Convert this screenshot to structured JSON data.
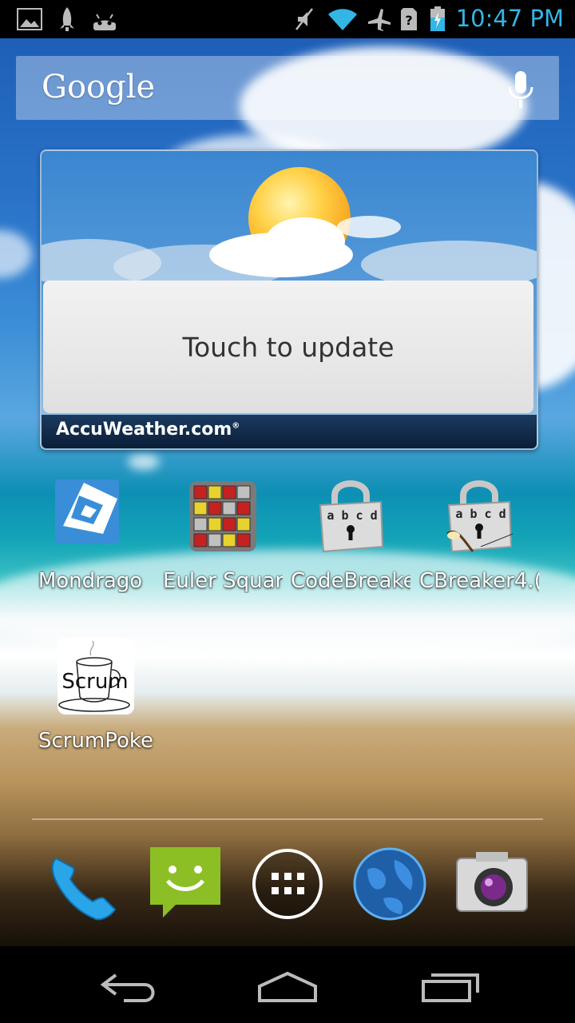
{
  "status_bar": {
    "time": "10:47 PM",
    "time_color": "#33b5e5",
    "left_icons": [
      "gallery-icon",
      "rocket-icon",
      "android-icon"
    ],
    "right_icons": [
      "muted-icon",
      "wifi-icon",
      "airplane-mode-icon",
      "sim-unknown-icon",
      "battery-charging-icon"
    ]
  },
  "search_bar": {
    "logo": "Google",
    "mic_icon": "microphone-icon"
  },
  "weather_widget": {
    "action_label": "Touch to update",
    "brand": "AccuWeather.com",
    "brand_mark": "®"
  },
  "apps": [
    {
      "label": "Mondrago",
      "icon": "mondrago-icon"
    },
    {
      "label": "Euler Squar",
      "icon": "euler-square-icon"
    },
    {
      "label": "CodeBreake",
      "icon": "codebreaker-lock-icon",
      "lock_text": "a b c d"
    },
    {
      "label": "CBreaker4.(",
      "icon": "cbreaker-vanilla-icon",
      "lock_text": "a b c d"
    },
    {
      "label": "ScrumPoke",
      "icon": "scrum-cup-icon",
      "icon_text": "Scrum"
    }
  ],
  "dock": [
    {
      "icon": "phone-icon"
    },
    {
      "icon": "messaging-icon"
    },
    {
      "icon": "app-drawer-icon"
    },
    {
      "icon": "browser-globe-icon"
    },
    {
      "icon": "camera-icon"
    }
  ],
  "nav_bar": {
    "buttons": [
      "back-icon",
      "home-icon",
      "recents-icon"
    ]
  }
}
